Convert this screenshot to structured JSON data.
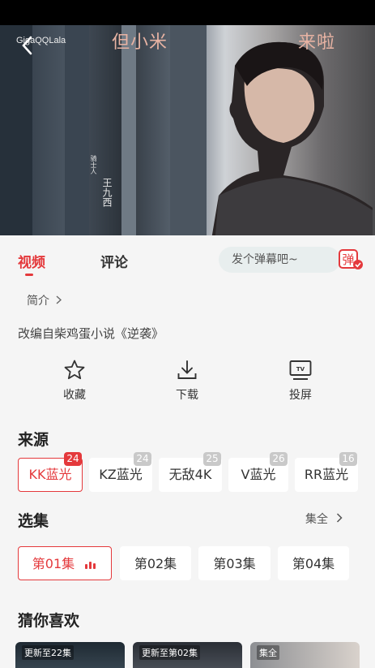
{
  "video": {
    "overlay_left": "但小米",
    "overlay_right": "来啦",
    "logo": "GigaQQLala",
    "credit_main": "王九西",
    "credit_small": "骑士人"
  },
  "tabs": {
    "video": "视频",
    "comments": "评论"
  },
  "danmu": {
    "placeholder": "发个弹幕吧~",
    "button": "弹"
  },
  "intro": {
    "label": "简介"
  },
  "description": "改编自柴鸡蛋小说《逆袭》",
  "actions": [
    {
      "label": "收藏",
      "icon": "star-icon"
    },
    {
      "label": "下载",
      "icon": "download-icon"
    },
    {
      "label": "投屏",
      "icon": "tv-icon"
    }
  ],
  "sources": {
    "title": "来源",
    "items": [
      {
        "label": "KK蓝光",
        "count": "24",
        "active": true
      },
      {
        "label": "KZ蓝光",
        "count": "24"
      },
      {
        "label": "无敌4K",
        "count": "25"
      },
      {
        "label": "V蓝光",
        "count": "26"
      },
      {
        "label": "RR蓝光",
        "count": "16"
      }
    ]
  },
  "episodes": {
    "title": "选集",
    "see_all": "集全",
    "items": [
      "第01集",
      "第02集",
      "第03集",
      "第04集"
    ]
  },
  "recommend": {
    "title": "猜你喜欢",
    "items": [
      {
        "tag": "更新至22集"
      },
      {
        "tag": "更新至第02集"
      },
      {
        "tag": "集全"
      }
    ]
  },
  "colors": {
    "accent": "#e4393c",
    "panel_bg": "#f5f5f5"
  }
}
